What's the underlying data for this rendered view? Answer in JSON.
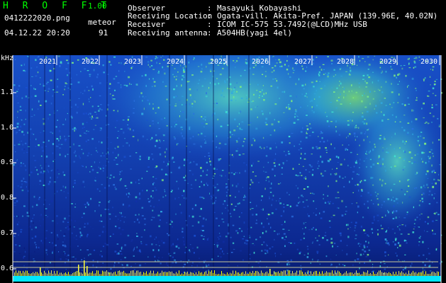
{
  "header": {
    "app_title": "H R O F F T",
    "version": "1.00",
    "filename": "0412222020.png",
    "meteor_label": "meteor",
    "datetime": "04.12.22 20:20",
    "meteor_count": "91"
  },
  "info": [
    {
      "label": "Observer",
      "value": "Masayuki Kobayashi"
    },
    {
      "label": "Receiving Location",
      "value": "Ogata-vill. Akita-Pref. JAPAN (139.96E, 40.02N)"
    },
    {
      "label": "Receiver",
      "value": "ICOM IC-575 53.7492(@LCD)MHz USB"
    },
    {
      "label": "Receiving antenna",
      "value": "A504HB(yagi 4el)"
    }
  ],
  "axis": {
    "unit": "kHz",
    "y_ticks": [
      "1.1",
      "1.0",
      "0.9",
      "0.8",
      "0.7",
      "0.6"
    ],
    "x_ticks": [
      "2021",
      "2022",
      "2023",
      "2024",
      "2025",
      "2026",
      "2027",
      "2028",
      "2029",
      "2030"
    ]
  },
  "colors": {
    "background": "#000000",
    "spectrum_dark": "#0a1a7a",
    "spectrum_mid": "#1a4fd0",
    "spectrum_bright": "#40e0d0",
    "spectrum_hot": "#a0ff40",
    "baseline": "#00e8ff",
    "meteor_marks": "#ffff00",
    "hline": "#c8c89a"
  }
}
